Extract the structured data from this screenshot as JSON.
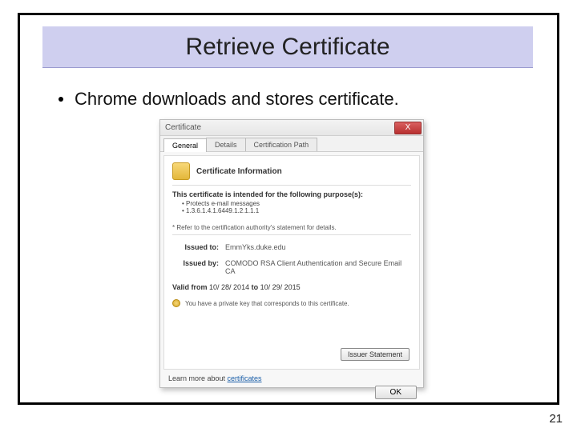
{
  "slide": {
    "title": "Retrieve Certificate",
    "bullet": "Chrome downloads and stores certificate.",
    "number": "21"
  },
  "dialog": {
    "title": "Certificate",
    "close_label": "X",
    "tabs": {
      "general": "General",
      "details": "Details",
      "path": "Certification Path"
    },
    "heading": "Certificate Information",
    "purpose_intro": "This certificate is intended for the following purpose(s):",
    "purposes": {
      "p1": "• Protects e-mail messages",
      "p2": "• 1.3.6.1.4.1.6449.1.2.1.1.1"
    },
    "footnote": "* Refer to the certification authority's statement for details.",
    "issued_to": {
      "label": "Issued to:",
      "value": "EmmYks.duke.edu"
    },
    "issued_by": {
      "label": "Issued by:",
      "value": "COMODO RSA Client Authentication and Secure Email CA"
    },
    "valid": {
      "label": "Valid from",
      "from": "10/ 28/ 2014",
      "to_word": "to",
      "to": "10/ 29/ 2015"
    },
    "key_note": "You have a private key that corresponds to this certificate.",
    "issuer_statement_btn": "Issuer Statement",
    "learn_prefix": "Learn more about ",
    "learn_link": "certificates",
    "ok": "OK"
  }
}
